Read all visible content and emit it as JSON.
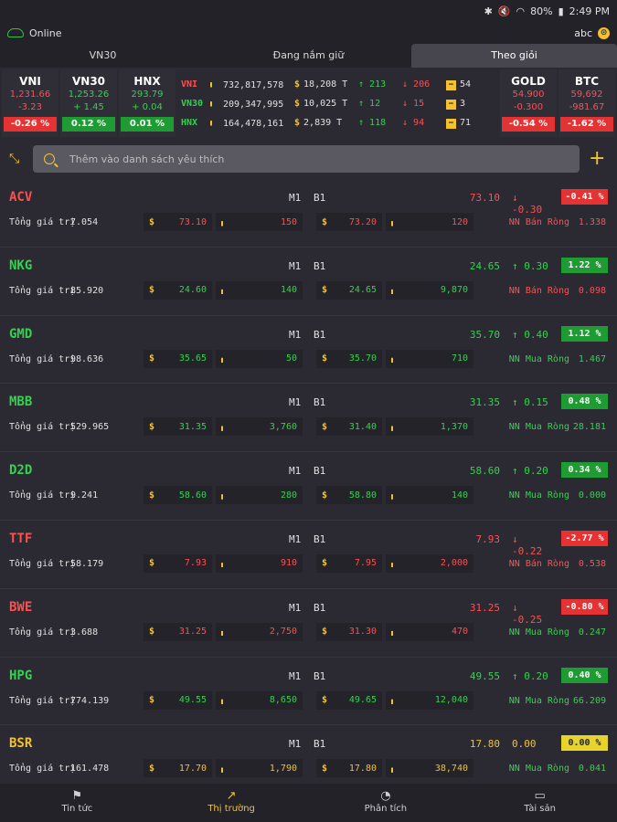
{
  "status": {
    "battery": "80%",
    "time": "2:49 PM"
  },
  "top": {
    "online": "Online",
    "user": "abc"
  },
  "tabs": [
    {
      "label": "VN30"
    },
    {
      "label": "Đang nắm giữ"
    },
    {
      "label": "Theo giỏi"
    }
  ],
  "indices_left": [
    {
      "name": "VNI",
      "value": "1,231.66",
      "change": "-3.23",
      "pct": "-0.26 %",
      "color": "red"
    },
    {
      "name": "VN30",
      "value": "1,253.26",
      "change": "+ 1.45",
      "pct": "0.12 %",
      "color": "green"
    },
    {
      "name": "HNX",
      "value": "293.79",
      "change": "+ 0.04",
      "pct": "0.01 %",
      "color": "green"
    }
  ],
  "index_table": [
    {
      "name": "VNI",
      "volume": "732,817,578",
      "value": "18,208 T",
      "up": "213",
      "down": "206",
      "ref": "54",
      "color": "red"
    },
    {
      "name": "VN30",
      "volume": "209,347,995",
      "value": "10,025 T",
      "up": "12",
      "down": "15",
      "ref": "3",
      "color": "green"
    },
    {
      "name": "HNX",
      "volume": "164,478,161",
      "value": "2,839 T",
      "up": "118",
      "down": "94",
      "ref": "71",
      "color": "green"
    }
  ],
  "indices_right": [
    {
      "name": "GOLD",
      "value": "54.900",
      "change": "-0.300",
      "pct": "-0.54 %",
      "color": "red"
    },
    {
      "name": "BTC",
      "value": "59,692",
      "change": "-981.67",
      "pct": "-1.62 %",
      "color": "red"
    }
  ],
  "search": {
    "placeholder": "Thêm vào danh sách yêu thích"
  },
  "labels": {
    "m1": "M1",
    "b1": "B1",
    "total": "Tổng giá trị"
  },
  "stocks": [
    {
      "symbol": "ACV",
      "color": "red",
      "price": "73.10",
      "change": "-0.30",
      "arrow": "↓",
      "pct": "-0.41 %",
      "total": "7.054",
      "m1_price": "73.10",
      "m1_vol": "150",
      "b1_price": "73.20",
      "b1_vol": "120",
      "nn_label": "NN Bán Ròng",
      "nn_value": "1.338",
      "nn_type": "sell",
      "price_color": "red",
      "b1_color": "red"
    },
    {
      "symbol": "NKG",
      "color": "green",
      "price": "24.65",
      "change": "0.30",
      "arrow": "↑",
      "pct": "1.22 %",
      "total": "85.920",
      "m1_price": "24.60",
      "m1_vol": "140",
      "b1_price": "24.65",
      "b1_vol": "9,870",
      "nn_label": "NN Bán Ròng",
      "nn_value": "0.098",
      "nn_type": "sell",
      "price_color": "green",
      "b1_color": "green"
    },
    {
      "symbol": "GMD",
      "color": "green",
      "price": "35.70",
      "change": "0.40",
      "arrow": "↑",
      "pct": "1.12 %",
      "total": "98.636",
      "m1_price": "35.65",
      "m1_vol": "50",
      "b1_price": "35.70",
      "b1_vol": "710",
      "nn_label": "NN Mua Ròng",
      "nn_value": "1.467",
      "nn_type": "buy",
      "price_color": "green",
      "b1_color": "green"
    },
    {
      "symbol": "MBB",
      "color": "green",
      "price": "31.35",
      "change": "0.15",
      "arrow": "↑",
      "pct": "0.48 %",
      "total": "529.965",
      "m1_price": "31.35",
      "m1_vol": "3,760",
      "b1_price": "31.40",
      "b1_vol": "1,370",
      "nn_label": "NN Mua Ròng",
      "nn_value": "28.181",
      "nn_type": "buy",
      "price_color": "green",
      "b1_color": "green"
    },
    {
      "symbol": "D2D",
      "color": "green",
      "price": "58.60",
      "change": "0.20",
      "arrow": "↑",
      "pct": "0.34 %",
      "total": "9.241",
      "m1_price": "58.60",
      "m1_vol": "280",
      "b1_price": "58.80",
      "b1_vol": "140",
      "nn_label": "NN Mua Ròng",
      "nn_value": "0.000",
      "nn_type": "buy",
      "price_color": "green",
      "b1_color": "green"
    },
    {
      "symbol": "TTF",
      "color": "red",
      "price": "7.93",
      "change": "-0.22",
      "arrow": "↓",
      "pct": "-2.77 %",
      "total": "58.179",
      "m1_price": "7.93",
      "m1_vol": "910",
      "b1_price": "7.95",
      "b1_vol": "2,000",
      "nn_label": "NN Bán Ròng",
      "nn_value": "0.538",
      "nn_type": "sell",
      "price_color": "red",
      "b1_color": "red"
    },
    {
      "symbol": "BWE",
      "color": "red",
      "price": "31.25",
      "change": "-0.25",
      "arrow": "↓",
      "pct": "-0.80 %",
      "total": "3.688",
      "m1_price": "31.25",
      "m1_vol": "2,750",
      "b1_price": "31.30",
      "b1_vol": "470",
      "nn_label": "NN Mua Ròng",
      "nn_value": "0.247",
      "nn_type": "buy",
      "price_color": "red",
      "b1_color": "red"
    },
    {
      "symbol": "HPG",
      "color": "green",
      "price": "49.55",
      "change": "0.20",
      "arrow": "↑",
      "pct": "0.40 %",
      "total": "774.139",
      "m1_price": "49.55",
      "m1_vol": "8,650",
      "b1_price": "49.65",
      "b1_vol": "12,040",
      "nn_label": "NN Mua Ròng",
      "nn_value": "66.209",
      "nn_type": "buy",
      "price_color": "green",
      "b1_color": "green"
    },
    {
      "symbol": "BSR",
      "color": "yellow",
      "price": "17.80",
      "change": "0.00",
      "arrow": "",
      "pct": "0.00 %",
      "total": "161.478",
      "m1_price": "17.70",
      "m1_vol": "1,790",
      "b1_price": "17.80",
      "b1_vol": "38,740",
      "nn_label": "NN Mua Ròng",
      "nn_value": "0.041",
      "nn_type": "buy",
      "price_color": "yellow",
      "b1_color": "yellow"
    }
  ],
  "nav": [
    {
      "label": "Tin tức",
      "icon": "flag-icon"
    },
    {
      "label": "Thị trường",
      "icon": "trend-icon"
    },
    {
      "label": "Phân tích",
      "icon": "pie-icon"
    },
    {
      "label": "Tài sản",
      "icon": "wallet-icon"
    }
  ],
  "colors": {
    "accent": "#f2c230",
    "up": "#35d14f",
    "down": "#ff4f4f",
    "bg": "#2b2a32"
  }
}
